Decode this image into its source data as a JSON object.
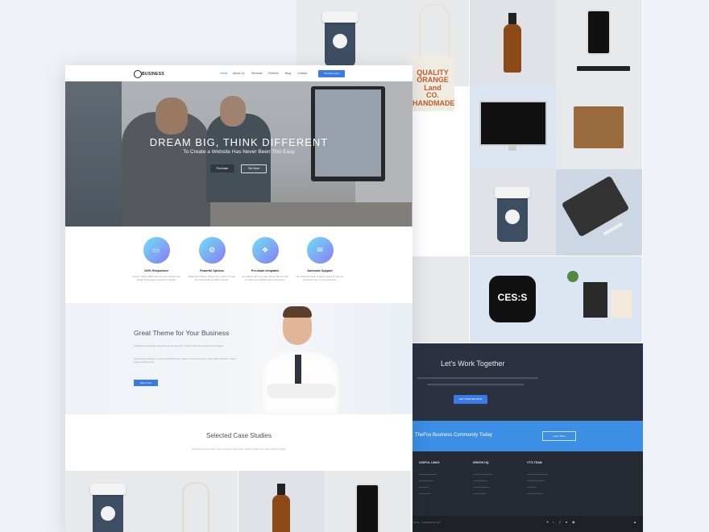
{
  "nav": {
    "brand": "BUSINESS",
    "links": [
      "Home",
      "About Us",
      "Services",
      "Portfolio",
      "Blog",
      "Contact"
    ],
    "cta": "Purchase Now"
  },
  "hero": {
    "title": "DREAM BIG, THINK DIFFERENT",
    "subtitle": "To Create a Website Has Never Been This Easy",
    "buttons": [
      "Purchase",
      "Get More"
    ]
  },
  "features": [
    {
      "title": "100% Responsive",
      "icon": "monitor-icon",
      "desc": "Cisdem TheFox Business can use it without any design of the page elements or visuals."
    },
    {
      "title": "Powerful Options",
      "icon": "gear-icon",
      "desc": "Build with a theme where every option is made for use and layout within seconds."
    },
    {
      "title": "Pre-made templates",
      "icon": "layers-icon",
      "desc": "Get started with pre-made demos that are built to make your website look professional."
    },
    {
      "title": "Awesome Support",
      "icon": "support-icon",
      "desc": "Our dedicated team is always ready to help you and answer any of your questions."
    }
  ],
  "about": {
    "title": "Great Theme for Your Business",
    "para1": "Candidus ex accumsan. Sed vehicula elit eget dolor. Viverra. Nulla sem mattis nibh ac feugiat.",
    "para2": "Suspendisse nisl lorem, congue sed facilisis quis, dapibus. Duis consectetur, tellus vitae bibendum. Integer sapien pharetra justo.",
    "button": "Take a Tour"
  },
  "case_studies": {
    "title": "Selected Case Studies",
    "desc": "Candidus ex accumsan. Sed vehicula elit eget dolor. Viverra. Nulla sem mattis nibh ac feugiat."
  },
  "back": {
    "bag_text": "QUALITY\nORANGE\nLand\nCO.\nHANDMADE",
    "watch_text": "CES:S",
    "cta_title": "Let's Work Together",
    "cta_button": "GET STARTED NOW",
    "band_text": "TheFox Business Community Today",
    "band_button": "Learn More",
    "footer_cols": [
      "USEFUL LINKS",
      "DRIVEN HQ",
      "YT'S TEAM"
    ],
    "copyright": "Theme ... Powered by Fox"
  },
  "colors": {
    "accent": "#3a7ae6",
    "dark": "#262b33",
    "band": "#3c8fe4"
  }
}
